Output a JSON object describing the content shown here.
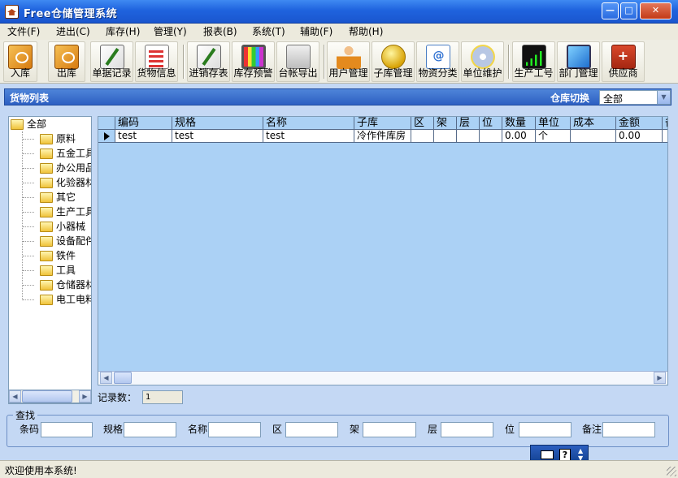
{
  "window": {
    "title": "Free仓储管理系统"
  },
  "menu": [
    "文件(F)",
    "进出(C)",
    "库存(H)",
    "管理(Y)",
    "报表(B)",
    "系统(T)",
    "辅助(F)",
    "帮助(H)"
  ],
  "toolbar": [
    {
      "label": "入库",
      "icon": "book-icon"
    },
    {
      "label": "出库",
      "icon": "book-icon"
    },
    {
      "label": "单据记录",
      "icon": "note-icon"
    },
    {
      "label": "货物信息",
      "icon": "list-icon"
    },
    {
      "label": "进销存表",
      "icon": "note-icon"
    },
    {
      "label": "库存预警",
      "icon": "monitor-icon"
    },
    {
      "label": "台帐导出",
      "icon": "printer-icon"
    },
    {
      "label": "用户管理",
      "icon": "user-icon"
    },
    {
      "label": "子库管理",
      "icon": "ball-icon"
    },
    {
      "label": "物资分类",
      "icon": "calendar-icon"
    },
    {
      "label": "单位维护",
      "icon": "cd-icon"
    },
    {
      "label": "生产工号",
      "icon": "chart-icon"
    },
    {
      "label": "部门管理",
      "icon": "screen-icon"
    },
    {
      "label": "供应商",
      "icon": "kit-icon"
    }
  ],
  "panel": {
    "title": "货物列表",
    "warehouse_label": "仓库切换",
    "warehouse_value": "全部"
  },
  "tree": {
    "root": "全部",
    "items": [
      "原料",
      "五金工具",
      "办公用品",
      "化验器材",
      "其它",
      "生产工具",
      "小器械",
      "设备配件",
      "铁件",
      "工具",
      "仓储器材",
      "电工电料"
    ]
  },
  "grid": {
    "columns": [
      "编码",
      "规格",
      "名称",
      "子库",
      "区",
      "架",
      "层",
      "位",
      "数量",
      "单位",
      "成本",
      "金额",
      "备"
    ],
    "rows": [
      [
        "test",
        "test",
        "test",
        "冷作件库房",
        "",
        "",
        "",
        "",
        "0.00",
        "个",
        "",
        "0.00",
        ""
      ]
    ]
  },
  "record_count": {
    "label": "记录数：",
    "value": "1"
  },
  "search": {
    "title": "查找",
    "fields": [
      "条码",
      "规格",
      "名称",
      "区",
      "架",
      "层",
      "位",
      "备注"
    ]
  },
  "status": {
    "text": "欢迎使用本系统!"
  }
}
